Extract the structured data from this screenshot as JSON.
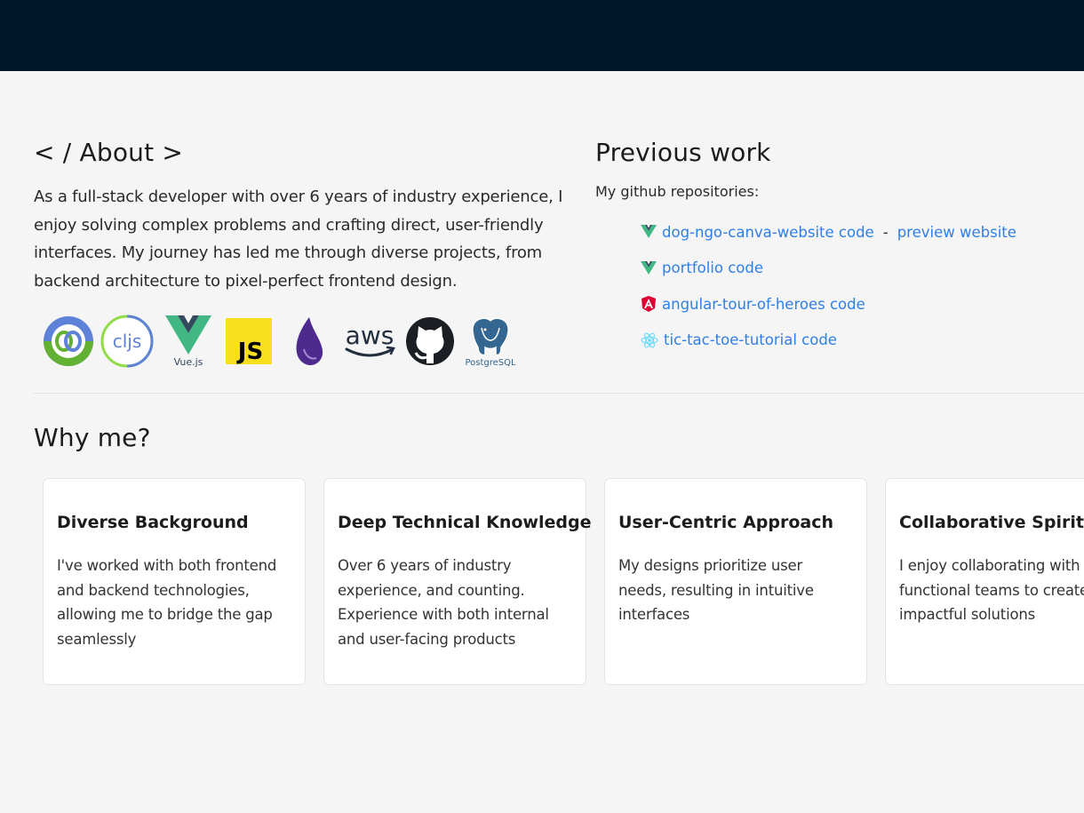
{
  "about": {
    "title": "< / About >",
    "text": "As a full-stack developer with over 6 years of industry experience, I enjoy solving complex problems and crafting direct, user-friendly interfaces. My journey has led me through diverse projects, from backend architecture to pixel-perfect frontend design.",
    "logo_text": {
      "cljs": "cljs",
      "vue": "Vue.js",
      "js": "JS",
      "aws": "aws",
      "postgres": "PostgreSQL"
    }
  },
  "previous_work": {
    "title": "Previous work",
    "subtitle": "My github repositories:",
    "repos": [
      {
        "icon": "vue-icon",
        "label": "dog-ngo-canva-website code",
        "separator": "-",
        "preview_label": "preview website"
      },
      {
        "icon": "vue-icon",
        "label": "portfolio code"
      },
      {
        "icon": "angular-icon",
        "label": "angular-tour-of-heroes code"
      },
      {
        "icon": "react-icon",
        "label": "tic-tac-toe-tutorial code"
      }
    ]
  },
  "why_me": {
    "title": "Why me?",
    "cards": [
      {
        "title": "Diverse Background",
        "text": "I've worked with both frontend and backend technologies, allowing me to bridge the gap seamlessly"
      },
      {
        "title": "Deep Technical Knowledge",
        "text": "Over 6 years of industry experience, and counting. Experience with both internal and user-facing products"
      },
      {
        "title": "User-Centric Approach",
        "text": "My designs prioritize user needs, resulting in intuitive interfaces"
      },
      {
        "title": "Collaborative Spirit",
        "text": "I enjoy collaborating with cross-functional teams to create impactful solutions"
      }
    ]
  },
  "colors": {
    "header_bg": "#001629",
    "page_bg": "#f5f5f5",
    "link": "#2f7fe6"
  }
}
